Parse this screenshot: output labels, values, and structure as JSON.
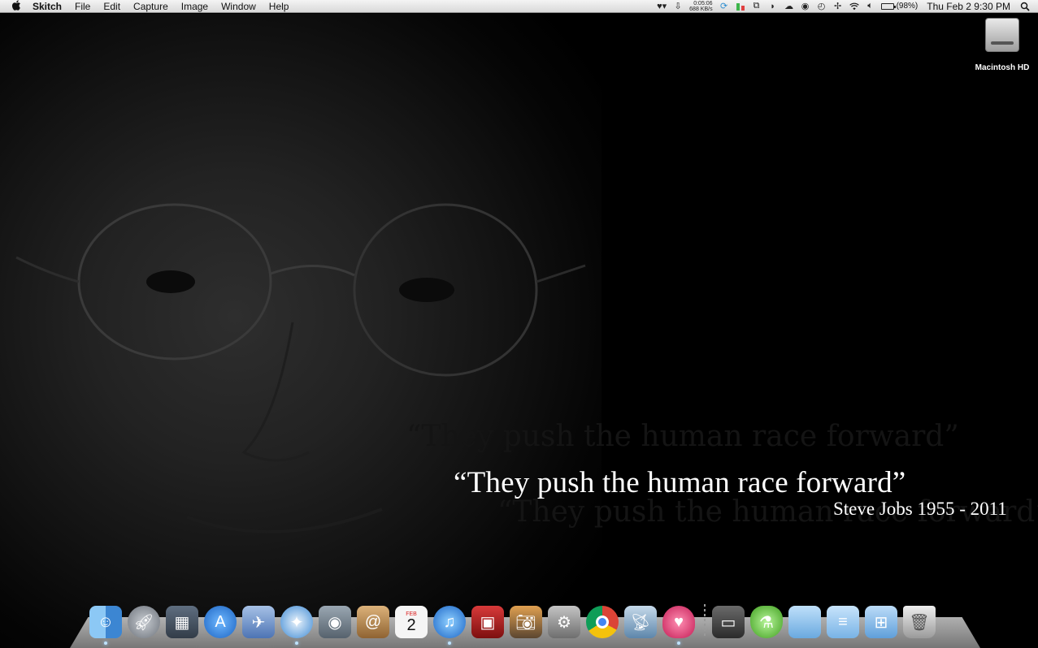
{
  "menubar": {
    "apple_icon": "apple-logo-icon",
    "app_name": "Skitch",
    "menus": [
      "File",
      "Edit",
      "Capture",
      "Image",
      "Window",
      "Help"
    ],
    "net_time": "0:05:06",
    "net_rate": "688 KB/s",
    "battery_percent": "(98%)",
    "battery_level": 0.98,
    "clock": "Thu Feb 2  9:30 PM"
  },
  "desktop": {
    "drive_label": "Macintosh HD"
  },
  "wallpaper": {
    "quote": "“They push the human race forward”",
    "author": "Steve Jobs 1955 - 2011"
  },
  "calendar": {
    "month": "FEB",
    "day": "2"
  },
  "dock": {
    "apps": [
      {
        "name": "finder-icon",
        "color": "#5aa4e6"
      },
      {
        "name": "launchpad-icon",
        "color": "#9aa0a8"
      },
      {
        "name": "mission-control-icon",
        "color": "#4d5b6b"
      },
      {
        "name": "app-store-icon",
        "color": "#2a86e0"
      },
      {
        "name": "preview-icon",
        "color": "#6f91c9"
      },
      {
        "name": "safari-icon",
        "color": "#3d8fd6"
      },
      {
        "name": "facetime-icon",
        "color": "#7d8c99"
      },
      {
        "name": "address-book-icon",
        "color": "#b98a4c"
      },
      {
        "name": "ical-icon",
        "color": "#f4f4f4"
      },
      {
        "name": "itunes-icon",
        "color": "#2c7fd8"
      },
      {
        "name": "photo-booth-icon",
        "color": "#b81e1e"
      },
      {
        "name": "iphoto-icon",
        "color": "#6b6b6b"
      },
      {
        "name": "system-preferences-icon",
        "color": "#8e8e8e"
      },
      {
        "name": "chrome-icon",
        "color": "#3c9a46"
      },
      {
        "name": "network-app-icon",
        "color": "#7fa7c7"
      },
      {
        "name": "heart-app-icon",
        "color": "#e2467a"
      }
    ],
    "stacks": [
      {
        "name": "dark-folder-icon",
        "color": "#4e4e4e"
      },
      {
        "name": "green-potion-icon",
        "color": "#6fcf3f"
      },
      {
        "name": "folder-icon",
        "color": "#8cc3ef"
      },
      {
        "name": "documents-folder-icon",
        "color": "#9dcbf2"
      },
      {
        "name": "downloads-folder-icon",
        "color": "#89bff0"
      },
      {
        "name": "trash-icon",
        "color": "#cfcfcf"
      }
    ]
  }
}
